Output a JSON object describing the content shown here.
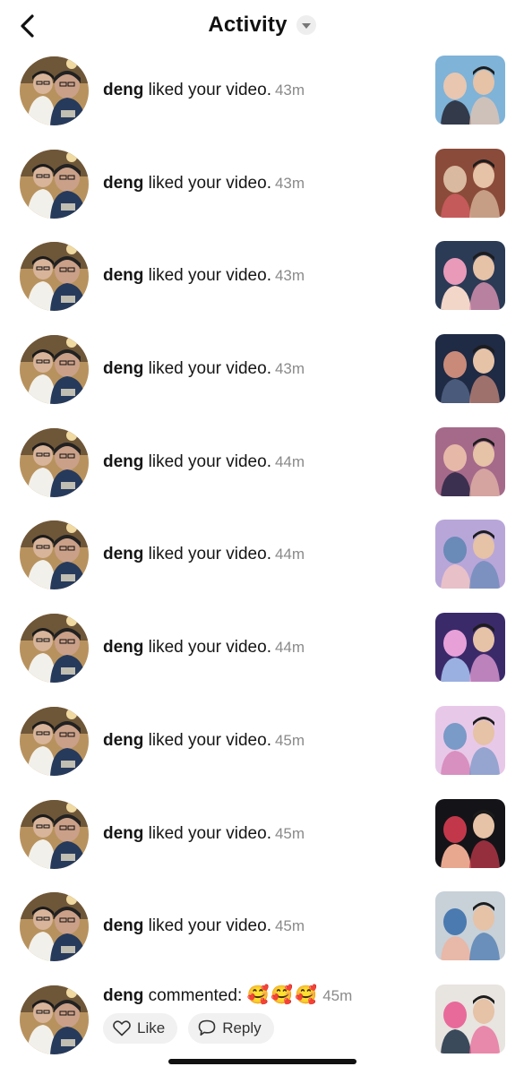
{
  "header": {
    "title": "Activity",
    "back_icon": "chevron-left-icon",
    "filter_icon": "caret-down-icon"
  },
  "notifications": [
    {
      "user": "deng",
      "action": "liked your video.",
      "time": "43m",
      "thumb_colors": [
        "#7fb3d8",
        "#e8c6b0",
        "#333a4a"
      ]
    },
    {
      "user": "deng",
      "action": "liked your video.",
      "time": "43m",
      "thumb_colors": [
        "#8a4b3a",
        "#d9b9a0",
        "#c45a5a"
      ]
    },
    {
      "user": "deng",
      "action": "liked your video.",
      "time": "43m",
      "thumb_colors": [
        "#2b3a55",
        "#e89ab8",
        "#f2d6c8"
      ]
    },
    {
      "user": "deng",
      "action": "liked your video.",
      "time": "43m",
      "thumb_colors": [
        "#1f2a44",
        "#c98a7a",
        "#4a5a7a"
      ]
    },
    {
      "user": "deng",
      "action": "liked your video.",
      "time": "44m",
      "thumb_colors": [
        "#a56a8a",
        "#e6b8a8",
        "#3c3050"
      ]
    },
    {
      "user": "deng",
      "action": "liked your video.",
      "time": "44m",
      "thumb_colors": [
        "#b8a6d9",
        "#6a8ab8",
        "#e8c0c8"
      ]
    },
    {
      "user": "deng",
      "action": "liked your video.",
      "time": "44m",
      "thumb_colors": [
        "#3a2a6a",
        "#e8a0d8",
        "#9ab0e0"
      ]
    },
    {
      "user": "deng",
      "action": "liked your video.",
      "time": "45m",
      "thumb_colors": [
        "#e8c8e8",
        "#7a9ac8",
        "#d890c0"
      ]
    },
    {
      "user": "deng",
      "action": "liked your video.",
      "time": "45m",
      "thumb_colors": [
        "#141418",
        "#c2384a",
        "#e8a890"
      ]
    },
    {
      "user": "deng",
      "action": "liked your video.",
      "time": "45m",
      "thumb_colors": [
        "#c8d0d8",
        "#4a7ab0",
        "#e8b8a8"
      ]
    }
  ],
  "comment": {
    "user": "deng",
    "action": "commented:",
    "emojis": "🥰🥰🥰",
    "time": "45m",
    "like_label": "Like",
    "reply_label": "Reply",
    "like_icon": "heart-outline-icon",
    "reply_icon": "speech-bubble-icon",
    "thumb_colors": [
      "#e8e4e0",
      "#e86a9a",
      "#3a4a5a"
    ]
  }
}
